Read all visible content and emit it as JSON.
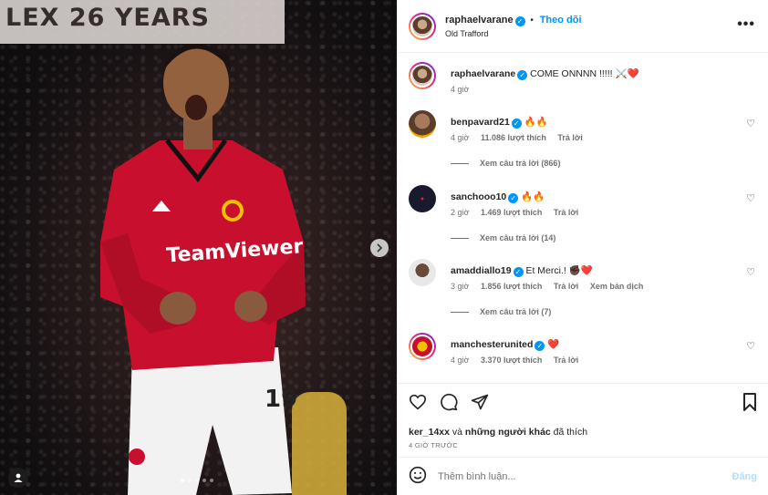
{
  "media": {
    "banner_text": "LEX 26 YEARS",
    "jersey_sponsor": "TeamViewer",
    "jersey_number": "19",
    "carousel_count": 5,
    "carousel_active": 1
  },
  "post_header": {
    "username": "raphaelvarane",
    "follow_label": "Theo dõi",
    "location": "Old Trafford",
    "more_label": "•••"
  },
  "caption": {
    "username": "raphaelvarane",
    "text": "COME ONNNN !!!!! ⚔️❤️",
    "time": "4 giờ"
  },
  "comments": [
    {
      "username": "benpavard21",
      "text": "🔥🔥",
      "time": "4 giờ",
      "likes": "11.086 lượt thích",
      "reply": "Trả lời",
      "view_replies": "Xem câu trả lời (866)"
    },
    {
      "username": "sanchooo10",
      "text": "🔥🔥",
      "time": "2 giờ",
      "likes": "1.469 lượt thích",
      "reply": "Trả lời",
      "view_replies": "Xem câu trả lời (14)"
    },
    {
      "username": "amaddiallo19",
      "text": "Et Merci.! ✊🏿❤️",
      "time": "3 giờ",
      "likes": "1.856 lượt thích",
      "reply": "Trả lời",
      "translate": "Xem bản dịch",
      "view_replies": "Xem câu trả lời (7)"
    },
    {
      "username": "manchesterunited",
      "text": "❤️",
      "time": "4 giờ",
      "likes": "3.370 lượt thích",
      "reply": "Trả lời"
    }
  ],
  "likes_line": {
    "user": "ker_14xx",
    "connector": "và",
    "others": "những người khác",
    "suffix": "đã thích"
  },
  "timestamp": "4 GIỜ TRƯỚC",
  "add_comment": {
    "placeholder": "Thêm bình luận...",
    "post_label": "Đăng"
  },
  "colors": {
    "accent": "#0095f6",
    "jersey_red": "#c8102e",
    "muted": "#737373"
  }
}
